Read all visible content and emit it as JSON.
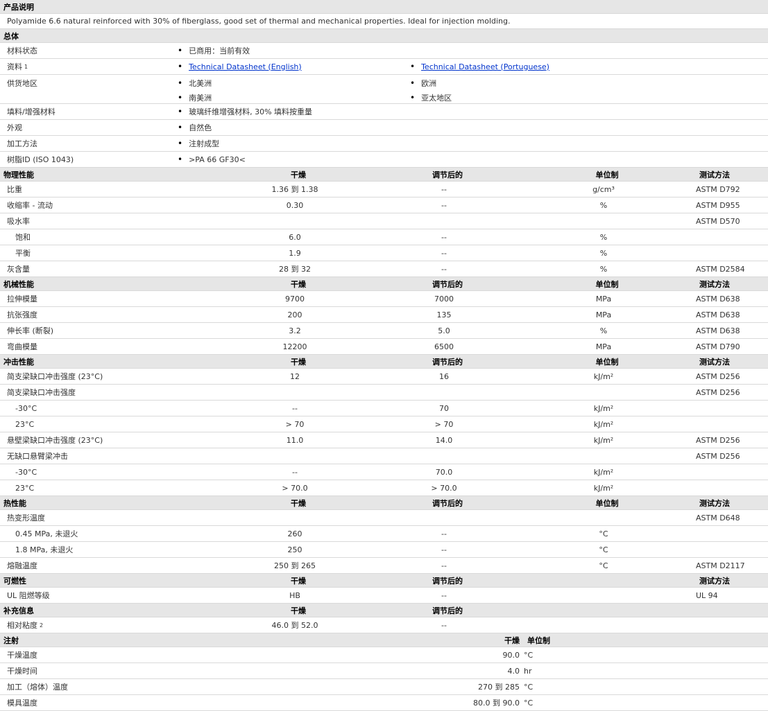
{
  "product": {
    "heading": "产品说明",
    "description": "Polyamide 6.6 natural reinforced with 30% of fiberglass, good set of thermal and mechanical properties. Ideal for injection molding."
  },
  "general": {
    "heading": "总体",
    "material_status": {
      "label": "材料状态",
      "value": "已商用：当前有效"
    },
    "literature": {
      "label": "资料",
      "sup": "1",
      "link1": "Technical Datasheet (English)",
      "link2": "Technical Datasheet (Portuguese)"
    },
    "availability": {
      "label": "供货地区",
      "r1c1": "北美洲",
      "r1c2": "欧洲",
      "r2c1": "南美洲",
      "r2c2": "亚太地区"
    },
    "filler": {
      "label": "填料/增强材料",
      "value": "玻璃纤维增强材料, 30% 填料按重量"
    },
    "appearance": {
      "label": "外观",
      "value": "自然色"
    },
    "processing": {
      "label": "加工方法",
      "value": "注射成型"
    },
    "resin_id": {
      "label": "树脂ID (ISO 1043)",
      "value": ">PA 66 GF30<"
    }
  },
  "cols": {
    "dry": "干燥",
    "cond": "调节后的",
    "unit": "单位制",
    "method": "测试方法"
  },
  "physical": {
    "heading": "物理性能",
    "rows": [
      {
        "label": "比重",
        "dry": "1.36 到  1.38",
        "cond": "--",
        "unit": "g/cm³",
        "method": "ASTM D792"
      },
      {
        "label": "收缩率  - 流动",
        "dry": "0.30",
        "cond": "--",
        "unit": "%",
        "method": "ASTM D955"
      },
      {
        "label": "吸水率",
        "dry": "",
        "cond": "",
        "unit": "",
        "method": "ASTM D570"
      },
      {
        "label": "饱和",
        "dry": "6.0",
        "cond": "--",
        "unit": "%",
        "method": "",
        "sub": true
      },
      {
        "label": "平衡",
        "dry": "1.9",
        "cond": "--",
        "unit": "%",
        "method": "",
        "sub": true
      },
      {
        "label": "灰含量",
        "dry": "28 到  32",
        "cond": "--",
        "unit": "%",
        "method": "ASTM D2584"
      }
    ]
  },
  "mechanical": {
    "heading": "机械性能",
    "rows": [
      {
        "label": "拉伸模量",
        "dry": "9700",
        "cond": "7000",
        "unit": "MPa",
        "method": "ASTM D638"
      },
      {
        "label": "抗张强度",
        "dry": "200",
        "cond": "135",
        "unit": "MPa",
        "method": "ASTM D638"
      },
      {
        "label": "伸长率  (断裂)",
        "dry": "3.2",
        "cond": "5.0",
        "unit": "%",
        "method": "ASTM D638"
      },
      {
        "label": "弯曲模量",
        "dry": "12200",
        "cond": "6500",
        "unit": "MPa",
        "method": "ASTM D790"
      }
    ]
  },
  "impact": {
    "heading": "冲击性能",
    "rows": [
      {
        "label": "简支梁缺口冲击强度  (23°C)",
        "dry": "12",
        "cond": "16",
        "unit": "kJ/m²",
        "method": "ASTM D256"
      },
      {
        "label": "简支梁缺口冲击强度",
        "dry": "",
        "cond": "",
        "unit": "",
        "method": "ASTM D256"
      },
      {
        "label": "-30°C",
        "dry": "--",
        "cond": "70",
        "unit": "kJ/m²",
        "method": "",
        "sub": true
      },
      {
        "label": "23°C",
        "dry": "> 70",
        "cond": "> 70",
        "unit": "kJ/m²",
        "method": "",
        "sub": true
      },
      {
        "label": "悬壁梁缺口冲击强度  (23°C)",
        "dry": "11.0",
        "cond": "14.0",
        "unit": "kJ/m²",
        "method": "ASTM D256"
      },
      {
        "label": "无缺口悬臂梁冲击",
        "dry": "",
        "cond": "",
        "unit": "",
        "method": "ASTM D256"
      },
      {
        "label": "-30°C",
        "dry": "--",
        "cond": "70.0",
        "unit": "kJ/m²",
        "method": "",
        "sub": true
      },
      {
        "label": "23°C",
        "dry": "> 70.0",
        "cond": "> 70.0",
        "unit": "kJ/m²",
        "method": "",
        "sub": true
      }
    ]
  },
  "thermal": {
    "heading": "热性能",
    "rows": [
      {
        "label": "热变形温度",
        "dry": "",
        "cond": "",
        "unit": "",
        "method": "ASTM D648"
      },
      {
        "label": "0.45 MPa, 未退火",
        "dry": "260",
        "cond": "--",
        "unit": "°C",
        "method": "",
        "sub": true
      },
      {
        "label": "1.8 MPa, 未退火",
        "dry": "250",
        "cond": "--",
        "unit": "°C",
        "method": "",
        "sub": true
      },
      {
        "label": "熔融温度",
        "dry": "250 到  265",
        "cond": "--",
        "unit": "°C",
        "method": "ASTM D2117"
      }
    ]
  },
  "flammability": {
    "heading": "可燃性",
    "rows": [
      {
        "label": "UL 阻燃等级",
        "dry": "HB",
        "cond": "--",
        "unit": "",
        "method": "UL 94"
      }
    ]
  },
  "supplemental": {
    "heading": "补充信息",
    "rows": [
      {
        "label": "相对粘度",
        "sup": "2",
        "dry": "46.0 到  52.0",
        "cond": "--"
      }
    ]
  },
  "injection": {
    "heading": "注射",
    "col_dry": "干燥",
    "col_unit": "单位制",
    "rows": [
      {
        "label": "干燥温度",
        "value": "90.0",
        "unit": "°C"
      },
      {
        "label": "干燥时间",
        "value": "4.0",
        "unit": "hr"
      },
      {
        "label": "加工（熔体）温度",
        "value": "270 到  285",
        "unit": "°C"
      },
      {
        "label": "模具温度",
        "value": "80.0 到  90.0",
        "unit": "°C"
      }
    ]
  }
}
